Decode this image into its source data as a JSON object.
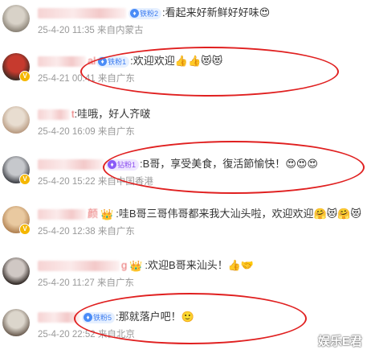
{
  "comments": [
    {
      "name_fragment": "",
      "badge": {
        "style": "blue",
        "label": "铁粉2"
      },
      "text": ":看起来好新鲜好好味",
      "emojis": "😍",
      "date": "25-4-20",
      "time": "11:35",
      "location": "来自内蒙古"
    },
    {
      "name_fragment": "al",
      "badge": {
        "style": "blue",
        "label": "铁粉1"
      },
      "text": ":欢迎欢迎",
      "emojis": "👍👍😻😻",
      "date": "25-4-21",
      "time": "00:41",
      "location": "来自广东"
    },
    {
      "name_fragment": "t",
      "badge": null,
      "text": ":哇哦，好人齐啵",
      "emojis": "",
      "date": "25-4-20",
      "time": "16:09",
      "location": "来自广东"
    },
    {
      "name_fragment": "",
      "badge": {
        "style": "purple",
        "label": "钻粉1"
      },
      "text": ":B哥，享受美食，復活節愉快！",
      "emojis": "😍😍😍",
      "date": "25-4-20",
      "time": "15:22",
      "location": "来自中国香港"
    },
    {
      "name_fragment": "颜",
      "badge": {
        "style": "crown",
        "label": ""
      },
      "text": ":哇B哥三哥伟哥都来我大汕头啦，欢迎欢迎",
      "emojis": "🤗😻🤗😻",
      "date": "25-4-20",
      "time": "12:38",
      "location": "来自广东"
    },
    {
      "name_fragment": "g",
      "badge": {
        "style": "crown",
        "label": ""
      },
      "text": ":欢迎B哥来汕头！",
      "emojis": "👍🤝",
      "date": "25-4-20",
      "time": "11:27",
      "location": "来自广东"
    },
    {
      "name_fragment": "",
      "badge": {
        "style": "blue",
        "label": "铁粉5"
      },
      "text": ":那就落户吧！",
      "emojis": "🙂",
      "date": "25-4-20",
      "time": "22:52",
      "location": "来自北京"
    }
  ],
  "watermark": "娱乐E君",
  "colors": {
    "highlight_circle": "#e02020",
    "meta_text": "#999999",
    "name_blur": "#f3c9c9"
  }
}
